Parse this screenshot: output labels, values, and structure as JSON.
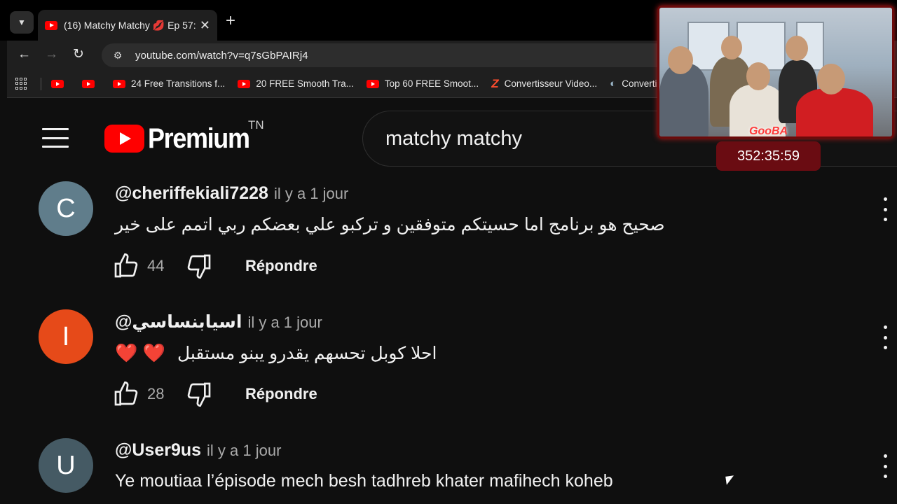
{
  "browser": {
    "tab": {
      "title": "(16) Matchy Matchy 💋 Ep 57: |",
      "close": "✕"
    },
    "new_tab": "+",
    "url": "youtube.com/watch?v=q7sGbPAIRj4",
    "bookmarks": [
      {
        "label": "",
        "icon": "youtube"
      },
      {
        "label": "",
        "icon": "youtube"
      },
      {
        "label": "24 Free Transitions f...",
        "icon": "youtube"
      },
      {
        "label": "20 FREE Smooth Tra...",
        "icon": "youtube"
      },
      {
        "label": "Top 60 FREE Smoot...",
        "icon": "youtube"
      },
      {
        "label": "Convertisseur Video...",
        "icon": "z-logo"
      },
      {
        "label": "Convertisseur",
        "icon": "converter-logo"
      }
    ]
  },
  "youtube": {
    "logo_text": "Premium",
    "country": "TN",
    "search_query": "matchy matchy"
  },
  "comments": [
    {
      "avatar_letter": "C",
      "avatar_color": "#607d8b",
      "author": "@cheriffekiali7228",
      "time": "il y a 1 jour",
      "text": "صحيح هو برنامج اما حسيتكم متوفقين و تركبو علي بعضكم ربي اتمم على خير",
      "likes": "44",
      "reply_label": "Répondre"
    },
    {
      "avatar_letter": "I",
      "avatar_color": "#e64a19",
      "author": "@اسيابنساسي",
      "time": "il y a 1 jour",
      "text": "احلا كوبل تحسهم يقدرو يبنو مستقبل",
      "hearts": "❤️ ❤️",
      "likes": "28",
      "reply_label": "Répondre"
    },
    {
      "avatar_letter": "U",
      "avatar_color": "#455a64",
      "author": "@User9us",
      "time": "il y a 1 jour",
      "text": "Ye moutiaa l’épisode mech besh tadhreb khater mafihech koheb"
    }
  ],
  "overlay": {
    "brand": "GooBA",
    "timer": "352:35:59",
    "accent": "#6a0c12"
  }
}
